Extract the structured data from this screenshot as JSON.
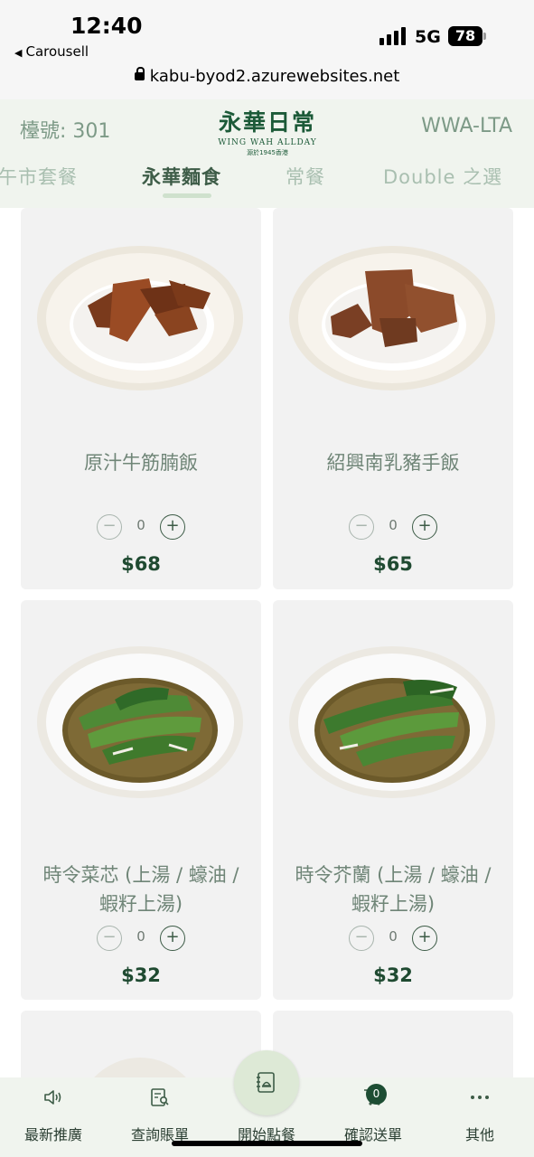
{
  "status_bar": {
    "time": "12:40",
    "back_app": "Carousell",
    "network": "5G",
    "battery": "78",
    "url": "kabu-byod2.azurewebsites.net"
  },
  "header": {
    "table_no": "檯號: 301",
    "store_code": "WWA-LTA",
    "logo_main": "永華日常",
    "logo_sub": "WING WAH ALLDAY",
    "logo_tag": "源於1945香港"
  },
  "tabs": [
    {
      "label": "午市套餐",
      "active": false
    },
    {
      "label": "永華麵食",
      "active": true
    },
    {
      "label": "常餐",
      "active": false
    },
    {
      "label": "Double 之選",
      "active": false
    }
  ],
  "menu_items": [
    {
      "name_line1": "原汁牛筋腩飯",
      "name_line2": "",
      "qty": "0",
      "price": "$68",
      "dish": "beef-brisket-rice"
    },
    {
      "name_line1": "紹興南乳豬手飯",
      "name_line2": "",
      "qty": "0",
      "price": "$65",
      "dish": "pork-knuckle-rice"
    },
    {
      "name_line1": "時令菜芯 (上湯 / 蠔油 /",
      "name_line2": "蝦籽上湯)",
      "qty": "0",
      "price": "$32",
      "dish": "choi-sum"
    },
    {
      "name_line1": "時令芥蘭 (上湯 / 蠔油 /",
      "name_line2": "蝦籽上湯)",
      "qty": "0",
      "price": "$32",
      "dish": "gai-lan"
    }
  ],
  "stepper": {
    "minus": "−",
    "plus": "+"
  },
  "bottom_nav": [
    {
      "label": "最新推廣",
      "icon": "speaker-icon"
    },
    {
      "label": "查詢賬單",
      "icon": "receipt-search-icon"
    },
    {
      "label": "開始點餐",
      "icon": "order-book-icon"
    },
    {
      "label": "確認送單",
      "icon": "cart-icon"
    },
    {
      "label": "其他",
      "icon": "more-icon"
    }
  ],
  "cart_count": "0",
  "colors": {
    "brand_green": "#1c5a38",
    "header_bg": "#f0f4ee",
    "card_bg": "#f2f2f2",
    "price": "#1f4a31"
  }
}
